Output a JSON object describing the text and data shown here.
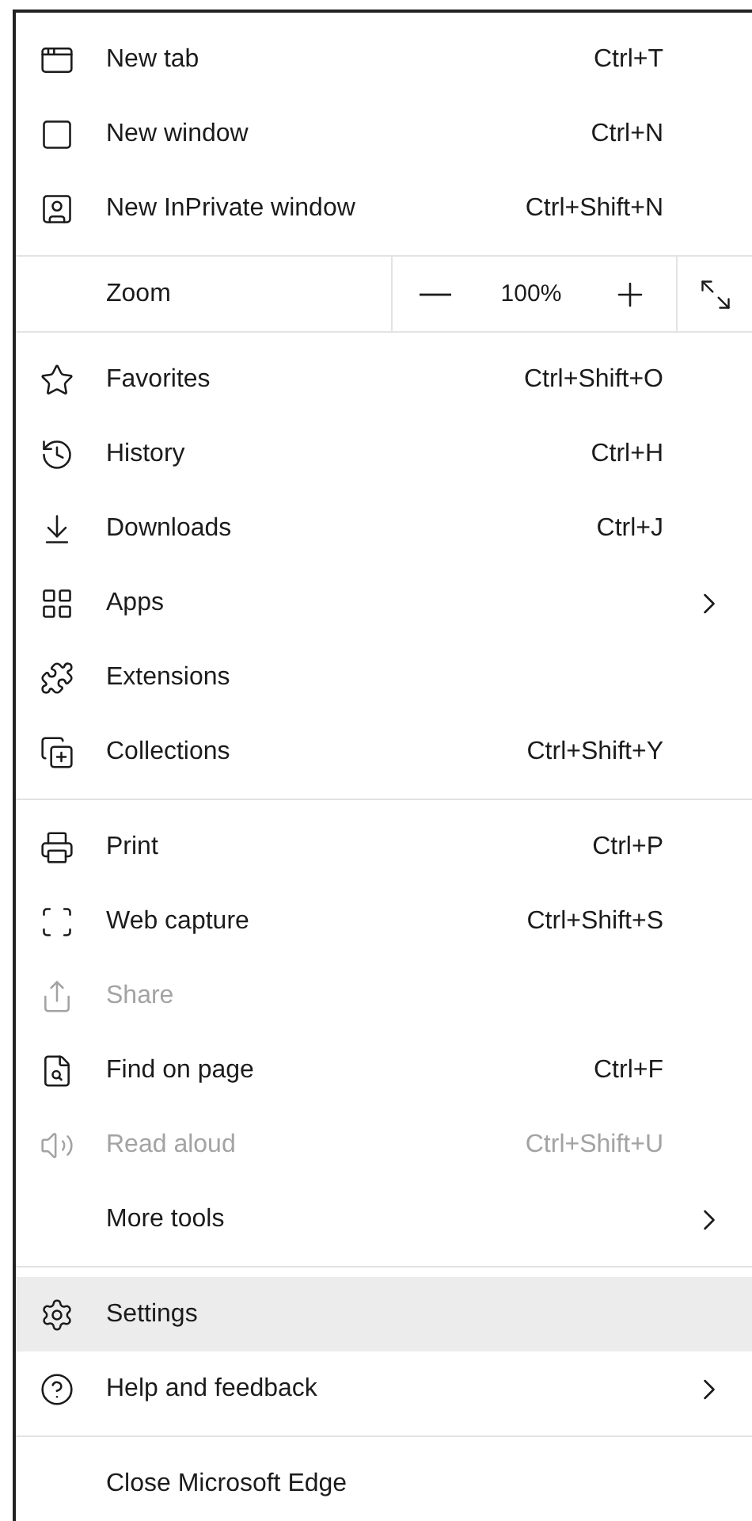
{
  "menu": {
    "sections": [
      {
        "kind": "items",
        "items": [
          {
            "label": "New tab",
            "shortcut": "Ctrl+T",
            "submenu": false,
            "disabled": false,
            "selected": false
          },
          {
            "label": "New window",
            "shortcut": "Ctrl+N",
            "submenu": false,
            "disabled": false,
            "selected": false
          },
          {
            "label": "New InPrivate window",
            "shortcut": "Ctrl+Shift+N",
            "submenu": false,
            "disabled": false,
            "selected": false
          }
        ]
      },
      {
        "kind": "zoom",
        "label": "Zoom",
        "value": "100%"
      },
      {
        "kind": "items",
        "items": [
          {
            "label": "Favorites",
            "shortcut": "Ctrl+Shift+O",
            "submenu": false,
            "disabled": false,
            "selected": false
          },
          {
            "label": "History",
            "shortcut": "Ctrl+H",
            "submenu": false,
            "disabled": false,
            "selected": false
          },
          {
            "label": "Downloads",
            "shortcut": "Ctrl+J",
            "submenu": false,
            "disabled": false,
            "selected": false
          },
          {
            "label": "Apps",
            "submenu": true,
            "disabled": false,
            "selected": false
          },
          {
            "label": "Extensions",
            "submenu": false,
            "disabled": false,
            "selected": false
          },
          {
            "label": "Collections",
            "shortcut": "Ctrl+Shift+Y",
            "submenu": false,
            "disabled": false,
            "selected": false
          }
        ]
      },
      {
        "kind": "items",
        "items": [
          {
            "label": "Print",
            "shortcut": "Ctrl+P",
            "submenu": false,
            "disabled": false,
            "selected": false
          },
          {
            "label": "Web capture",
            "shortcut": "Ctrl+Shift+S",
            "submenu": false,
            "disabled": false,
            "selected": false
          },
          {
            "label": "Share",
            "submenu": false,
            "disabled": true,
            "selected": false
          },
          {
            "label": "Find on page",
            "shortcut": "Ctrl+F",
            "submenu": false,
            "disabled": false,
            "selected": false
          },
          {
            "label": "Read aloud",
            "shortcut": "Ctrl+Shift+U",
            "submenu": false,
            "disabled": true,
            "selected": false
          },
          {
            "label": "More tools",
            "submenu": true,
            "disabled": false,
            "selected": false
          }
        ]
      },
      {
        "kind": "items",
        "items": [
          {
            "label": "Settings",
            "submenu": false,
            "disabled": false,
            "selected": true
          },
          {
            "label": "Help and feedback",
            "submenu": true,
            "disabled": false,
            "selected": false
          }
        ]
      },
      {
        "kind": "items",
        "items": [
          {
            "label": "Close Microsoft Edge",
            "submenu": false,
            "disabled": false,
            "selected": false
          }
        ]
      }
    ]
  }
}
